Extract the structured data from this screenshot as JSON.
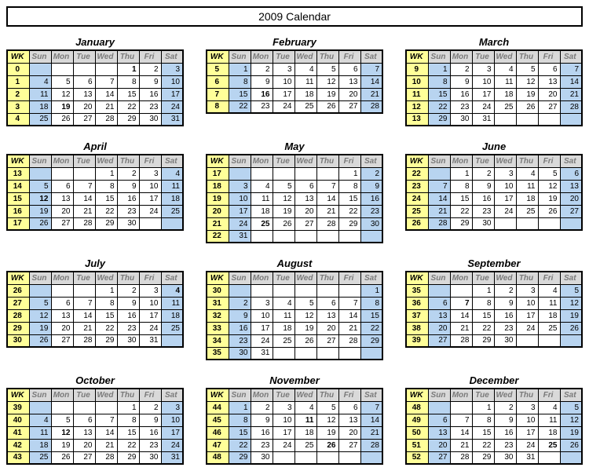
{
  "title": "2009 Calendar",
  "weekHeader": "WK",
  "dayHeaders": [
    "Sun",
    "Mon",
    "Tue",
    "Wed",
    "Thu",
    "Fri",
    "Sat"
  ],
  "months": [
    {
      "name": "January",
      "weeks": [
        {
          "wk": "0",
          "days": [
            "",
            "",
            "",
            "",
            "1",
            "2",
            "3"
          ],
          "bold": [
            4
          ]
        },
        {
          "wk": "1",
          "days": [
            "4",
            "5",
            "6",
            "7",
            "8",
            "9",
            "10"
          ]
        },
        {
          "wk": "2",
          "days": [
            "11",
            "12",
            "13",
            "14",
            "15",
            "16",
            "17"
          ]
        },
        {
          "wk": "3",
          "days": [
            "18",
            "19",
            "20",
            "21",
            "22",
            "23",
            "24"
          ],
          "bold": [
            1
          ]
        },
        {
          "wk": "4",
          "days": [
            "25",
            "26",
            "27",
            "28",
            "29",
            "30",
            "31"
          ]
        }
      ]
    },
    {
      "name": "February",
      "weeks": [
        {
          "wk": "5",
          "days": [
            "1",
            "2",
            "3",
            "4",
            "5",
            "6",
            "7"
          ]
        },
        {
          "wk": "6",
          "days": [
            "8",
            "9",
            "10",
            "11",
            "12",
            "13",
            "14"
          ]
        },
        {
          "wk": "7",
          "days": [
            "15",
            "16",
            "17",
            "18",
            "19",
            "20",
            "21"
          ],
          "bold": [
            1
          ]
        },
        {
          "wk": "8",
          "days": [
            "22",
            "23",
            "24",
            "25",
            "26",
            "27",
            "28"
          ]
        }
      ]
    },
    {
      "name": "March",
      "weeks": [
        {
          "wk": "9",
          "days": [
            "1",
            "2",
            "3",
            "4",
            "5",
            "6",
            "7"
          ]
        },
        {
          "wk": "10",
          "days": [
            "8",
            "9",
            "10",
            "11",
            "12",
            "13",
            "14"
          ]
        },
        {
          "wk": "11",
          "days": [
            "15",
            "16",
            "17",
            "18",
            "19",
            "20",
            "21"
          ]
        },
        {
          "wk": "12",
          "days": [
            "22",
            "23",
            "24",
            "25",
            "26",
            "27",
            "28"
          ]
        },
        {
          "wk": "13",
          "days": [
            "29",
            "30",
            "31",
            "",
            "",
            "",
            ""
          ]
        }
      ]
    },
    {
      "name": "April",
      "weeks": [
        {
          "wk": "13",
          "days": [
            "",
            "",
            "",
            "1",
            "2",
            "3",
            "4"
          ]
        },
        {
          "wk": "14",
          "days": [
            "5",
            "6",
            "7",
            "8",
            "9",
            "10",
            "11"
          ]
        },
        {
          "wk": "15",
          "days": [
            "12",
            "13",
            "14",
            "15",
            "16",
            "17",
            "18"
          ],
          "bold": [
            0
          ]
        },
        {
          "wk": "16",
          "days": [
            "19",
            "20",
            "21",
            "22",
            "23",
            "24",
            "25"
          ]
        },
        {
          "wk": "17",
          "days": [
            "26",
            "27",
            "28",
            "29",
            "30",
            "",
            ""
          ]
        }
      ]
    },
    {
      "name": "May",
      "weeks": [
        {
          "wk": "17",
          "days": [
            "",
            "",
            "",
            "",
            "",
            "1",
            "2"
          ]
        },
        {
          "wk": "18",
          "days": [
            "3",
            "4",
            "5",
            "6",
            "7",
            "8",
            "9"
          ]
        },
        {
          "wk": "19",
          "days": [
            "10",
            "11",
            "12",
            "13",
            "14",
            "15",
            "16"
          ]
        },
        {
          "wk": "20",
          "days": [
            "17",
            "18",
            "19",
            "20",
            "21",
            "22",
            "23"
          ]
        },
        {
          "wk": "21",
          "days": [
            "24",
            "25",
            "26",
            "27",
            "28",
            "29",
            "30"
          ],
          "bold": [
            1
          ]
        },
        {
          "wk": "22",
          "days": [
            "31",
            "",
            "",
            "",
            "",
            "",
            ""
          ]
        }
      ]
    },
    {
      "name": "June",
      "weeks": [
        {
          "wk": "22",
          "days": [
            "",
            "1",
            "2",
            "3",
            "4",
            "5",
            "6"
          ]
        },
        {
          "wk": "23",
          "days": [
            "7",
            "8",
            "9",
            "10",
            "11",
            "12",
            "13"
          ]
        },
        {
          "wk": "24",
          "days": [
            "14",
            "15",
            "16",
            "17",
            "18",
            "19",
            "20"
          ]
        },
        {
          "wk": "25",
          "days": [
            "21",
            "22",
            "23",
            "24",
            "25",
            "26",
            "27"
          ]
        },
        {
          "wk": "26",
          "days": [
            "28",
            "29",
            "30",
            "",
            "",
            "",
            ""
          ]
        }
      ]
    },
    {
      "name": "July",
      "weeks": [
        {
          "wk": "26",
          "days": [
            "",
            "",
            "",
            "1",
            "2",
            "3",
            "4"
          ],
          "bold": [
            6
          ]
        },
        {
          "wk": "27",
          "days": [
            "5",
            "6",
            "7",
            "8",
            "9",
            "10",
            "11"
          ]
        },
        {
          "wk": "28",
          "days": [
            "12",
            "13",
            "14",
            "15",
            "16",
            "17",
            "18"
          ]
        },
        {
          "wk": "29",
          "days": [
            "19",
            "20",
            "21",
            "22",
            "23",
            "24",
            "25"
          ]
        },
        {
          "wk": "30",
          "days": [
            "26",
            "27",
            "28",
            "29",
            "30",
            "31",
            ""
          ]
        }
      ]
    },
    {
      "name": "August",
      "weeks": [
        {
          "wk": "30",
          "days": [
            "",
            "",
            "",
            "",
            "",
            "",
            "1"
          ]
        },
        {
          "wk": "31",
          "days": [
            "2",
            "3",
            "4",
            "5",
            "6",
            "7",
            "8"
          ]
        },
        {
          "wk": "32",
          "days": [
            "9",
            "10",
            "11",
            "12",
            "13",
            "14",
            "15"
          ]
        },
        {
          "wk": "33",
          "days": [
            "16",
            "17",
            "18",
            "19",
            "20",
            "21",
            "22"
          ]
        },
        {
          "wk": "34",
          "days": [
            "23",
            "24",
            "25",
            "26",
            "27",
            "28",
            "29"
          ]
        },
        {
          "wk": "35",
          "days": [
            "30",
            "31",
            "",
            "",
            "",
            "",
            ""
          ]
        }
      ]
    },
    {
      "name": "September",
      "weeks": [
        {
          "wk": "35",
          "days": [
            "",
            "",
            "1",
            "2",
            "3",
            "4",
            "5"
          ]
        },
        {
          "wk": "36",
          "days": [
            "6",
            "7",
            "8",
            "9",
            "10",
            "11",
            "12"
          ],
          "bold": [
            1
          ]
        },
        {
          "wk": "37",
          "days": [
            "13",
            "14",
            "15",
            "16",
            "17",
            "18",
            "19"
          ]
        },
        {
          "wk": "38",
          "days": [
            "20",
            "21",
            "22",
            "23",
            "24",
            "25",
            "26"
          ]
        },
        {
          "wk": "39",
          "days": [
            "27",
            "28",
            "29",
            "30",
            "",
            "",
            ""
          ]
        }
      ]
    },
    {
      "name": "October",
      "weeks": [
        {
          "wk": "39",
          "days": [
            "",
            "",
            "",
            "",
            "1",
            "2",
            "3"
          ]
        },
        {
          "wk": "40",
          "days": [
            "4",
            "5",
            "6",
            "7",
            "8",
            "9",
            "10"
          ]
        },
        {
          "wk": "41",
          "days": [
            "11",
            "12",
            "13",
            "14",
            "15",
            "16",
            "17"
          ],
          "bold": [
            1
          ]
        },
        {
          "wk": "42",
          "days": [
            "18",
            "19",
            "20",
            "21",
            "22",
            "23",
            "24"
          ]
        },
        {
          "wk": "43",
          "days": [
            "25",
            "26",
            "27",
            "28",
            "29",
            "30",
            "31"
          ]
        }
      ]
    },
    {
      "name": "November",
      "weeks": [
        {
          "wk": "44",
          "days": [
            "1",
            "2",
            "3",
            "4",
            "5",
            "6",
            "7"
          ]
        },
        {
          "wk": "45",
          "days": [
            "8",
            "9",
            "10",
            "11",
            "12",
            "13",
            "14"
          ],
          "bold": [
            3
          ]
        },
        {
          "wk": "46",
          "days": [
            "15",
            "16",
            "17",
            "18",
            "19",
            "20",
            "21"
          ]
        },
        {
          "wk": "47",
          "days": [
            "22",
            "23",
            "24",
            "25",
            "26",
            "27",
            "28"
          ],
          "bold": [
            4
          ]
        },
        {
          "wk": "48",
          "days": [
            "29",
            "30",
            "",
            "",
            "",
            "",
            ""
          ]
        }
      ]
    },
    {
      "name": "December",
      "weeks": [
        {
          "wk": "48",
          "days": [
            "",
            "",
            "1",
            "2",
            "3",
            "4",
            "5"
          ]
        },
        {
          "wk": "49",
          "days": [
            "6",
            "7",
            "8",
            "9",
            "10",
            "11",
            "12"
          ]
        },
        {
          "wk": "50",
          "days": [
            "13",
            "14",
            "15",
            "16",
            "17",
            "18",
            "19"
          ]
        },
        {
          "wk": "51",
          "days": [
            "20",
            "21",
            "22",
            "23",
            "24",
            "25",
            "26"
          ],
          "bold": [
            5
          ]
        },
        {
          "wk": "52",
          "days": [
            "27",
            "28",
            "29",
            "30",
            "31",
            "",
            ""
          ]
        }
      ]
    }
  ]
}
